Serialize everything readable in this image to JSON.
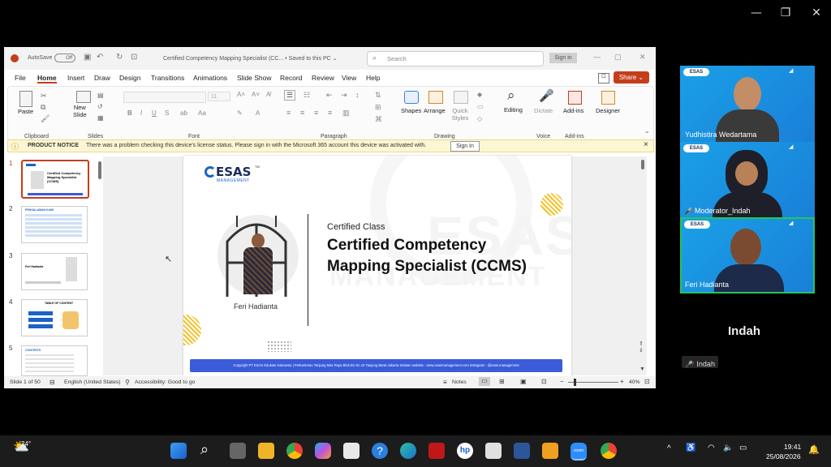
{
  "colors": {
    "accent": "#c43e1c",
    "ribbon_bg": "#fbfbfb",
    "zoom_blue": "#1a8fe3",
    "slide_blue": "#3b5bd9",
    "tile_highlight": "#23c55e"
  },
  "window_controls": {
    "minimize_icon": "minimize-icon",
    "restore_icon": "restore-icon",
    "close_icon": "close-icon",
    "minimize": "—",
    "restore": "❐",
    "close": "✕"
  },
  "ppt": {
    "titlebar": {
      "autosave_label": "AutoSave",
      "autosave_state": "Off",
      "doc_title": "Certified Competency Mapping Specialist (CC...  •  Saved to this PC ⌄",
      "search_placeholder": "Search",
      "signin": "Sign in"
    },
    "menu": [
      "File",
      "Home",
      "Insert",
      "Draw",
      "Design",
      "Transitions",
      "Animations",
      "Slide Show",
      "Record",
      "Review",
      "View",
      "Help"
    ],
    "share": "Share",
    "ribbon": {
      "paste": "Paste",
      "clipboard": "Clipboard",
      "new_slide": "New\nSlide",
      "slides": "Slides",
      "font": "Font",
      "font_size": "11",
      "paragraph": "Paragraph",
      "shapes": "Shapes",
      "arrange": "Arrange",
      "quick_styles": "Quick Styles",
      "drawing": "Drawing",
      "editing": "Editing",
      "dictate": "Dictate",
      "voice": "Voice",
      "addins": "Add-ins",
      "addins_group": "Add-ins",
      "designer": "Designer"
    },
    "notice": {
      "label": "PRODUCT NOTICE",
      "text": "There was a problem checking this device's license status. Please sign in with the Microsoft 365 account this device was activated with.",
      "button": "Sign In",
      "close": "×"
    },
    "thumbs": [
      {
        "num": "1",
        "title": "Certified Competency Mapping Specialist (CCMS)"
      },
      {
        "num": "2",
        "title": "PENGALAMAN KAMI"
      },
      {
        "num": "3",
        "title": "Feri Hadianta"
      },
      {
        "num": "4",
        "title": "TABLE OF CONTENT"
      },
      {
        "num": "5",
        "title": "CONTENTS"
      }
    ],
    "slide": {
      "logo": "ESAS",
      "logo_sub": "MANAGEMENT",
      "logo_tm": "TM",
      "small_title": "Certified Class",
      "main_title_1": "Certified Competency",
      "main_title_2": "Mapping Specialist (CCMS)",
      "presenter": "Feri Hadianta",
      "footer": "Copyright PT ESAS Edukasi Indonesia  |  Perkantoran Tanjung Mas Raya Blok B1 No 44 Tanjung Barat Jakarta Selatan website : www.esasmanagement.com instagram : @esas.management",
      "watermark_1": "ESAS",
      "watermark_2": "MANAGEMENT"
    },
    "status": {
      "slide_of": "Slide 1 of 50",
      "language": "English (United States)",
      "accessibility": "Accessibility: Good to go",
      "notes": "Notes",
      "zoom": "40%"
    }
  },
  "participants": [
    {
      "name": "Yudhistira Wedartama",
      "muted": false,
      "highlight": false,
      "logo": "ESAS"
    },
    {
      "name": "Moderator_Indah",
      "muted": true,
      "highlight": false,
      "logo": "ESAS"
    },
    {
      "name": "Feri Hadianta",
      "muted": false,
      "highlight": true,
      "logo": "ESAS"
    }
  ],
  "active_speaker": {
    "big_name": "Indah",
    "label": "Indah"
  },
  "taskbar": {
    "weather": "24°",
    "apps": [
      "start-icon",
      "search-icon",
      "task-view-icon",
      "file-explorer-icon",
      "chrome-icon",
      "copilot-icon",
      "store-icon",
      "help-icon",
      "edge-icon",
      "mcafee-icon",
      "hp-icon",
      "dms-icon",
      "word-icon",
      "media-icon",
      "zoom-icon",
      "chrome-alt-icon"
    ],
    "time": "19:41",
    "date": "25/08/2026",
    "zoom_label": "zoom"
  }
}
